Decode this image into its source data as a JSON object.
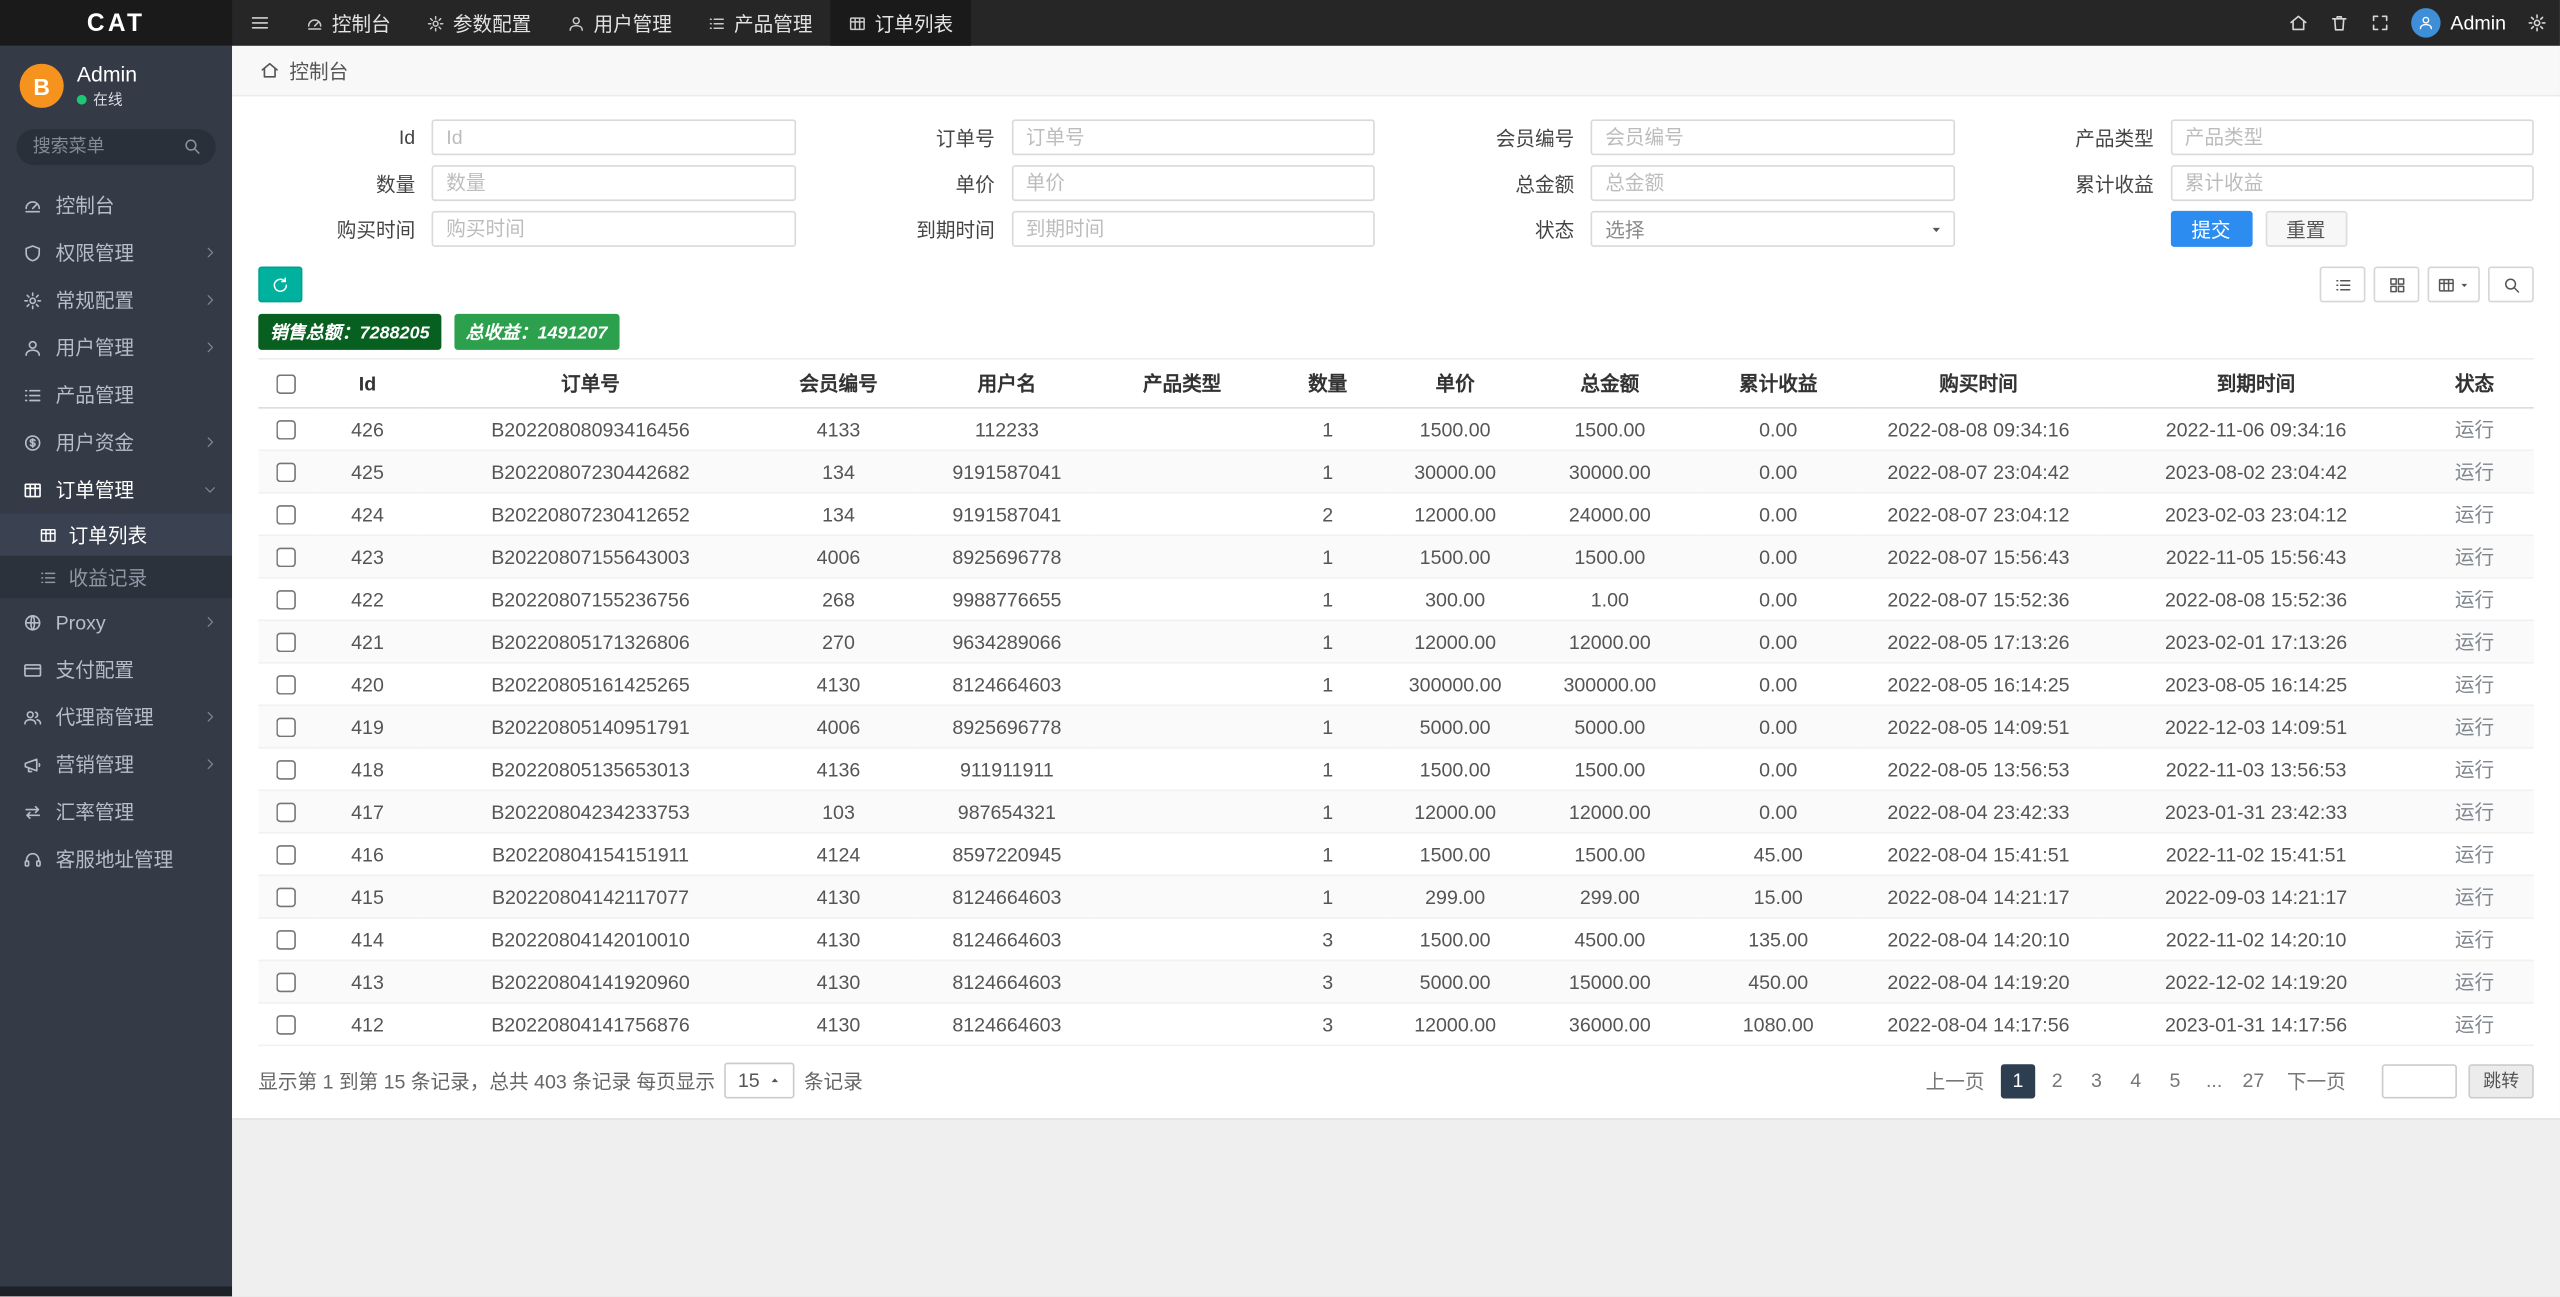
{
  "brand": {
    "logo": "CAT"
  },
  "topnav": {
    "items": [
      {
        "label": "控制台",
        "icon": "gauge"
      },
      {
        "label": "参数配置",
        "icon": "gear"
      },
      {
        "label": "用户管理",
        "icon": "user"
      },
      {
        "label": "产品管理",
        "icon": "list"
      },
      {
        "label": "订单列表",
        "icon": "table",
        "active": true
      }
    ],
    "user_label": "Admin"
  },
  "sidebar": {
    "user": {
      "name": "Admin",
      "status": "在线",
      "avatar_letter": "B"
    },
    "search_placeholder": "搜索菜单",
    "items": [
      {
        "label": "控制台",
        "icon": "gauge"
      },
      {
        "label": "权限管理",
        "icon": "shield",
        "expandable": true
      },
      {
        "label": "常规配置",
        "icon": "gear",
        "expandable": true
      },
      {
        "label": "用户管理",
        "icon": "user",
        "expandable": true
      },
      {
        "label": "产品管理",
        "icon": "list"
      },
      {
        "label": "用户资金",
        "icon": "money",
        "expandable": true
      },
      {
        "label": "订单管理",
        "icon": "table",
        "expandable": true,
        "expanded": true,
        "children": [
          {
            "label": "订单列表",
            "icon": "table",
            "active": true
          },
          {
            "label": "收益记录",
            "icon": "list"
          }
        ]
      },
      {
        "label": "Proxy",
        "icon": "globe",
        "expandable": true
      },
      {
        "label": "支付配置",
        "icon": "card"
      },
      {
        "label": "代理商管理",
        "icon": "users",
        "expandable": true
      },
      {
        "label": "营销管理",
        "icon": "megaphone",
        "expandable": true
      },
      {
        "label": "汇率管理",
        "icon": "exchange"
      },
      {
        "label": "客服地址管理",
        "icon": "headset"
      }
    ]
  },
  "breadcrumb": {
    "label": "控制台"
  },
  "filters": {
    "fields": [
      {
        "label": "Id",
        "placeholder": "Id"
      },
      {
        "label": "订单号",
        "placeholder": "订单号"
      },
      {
        "label": "会员编号",
        "placeholder": "会员编号"
      },
      {
        "label": "产品类型",
        "placeholder": "产品类型"
      },
      {
        "label": "数量",
        "placeholder": "数量"
      },
      {
        "label": "单价",
        "placeholder": "单价"
      },
      {
        "label": "总金额",
        "placeholder": "总金额"
      },
      {
        "label": "累计收益",
        "placeholder": "累计收益"
      },
      {
        "label": "购买时间",
        "placeholder": "购买时间"
      },
      {
        "label": "到期时间",
        "placeholder": "到期时间"
      },
      {
        "label": "状态",
        "type": "select",
        "value": "选择"
      }
    ],
    "submit_label": "提交",
    "reset_label": "重置"
  },
  "summary": {
    "sales_label": "销售总额：",
    "sales_value": "7288205",
    "profit_label": "总收益：",
    "profit_value": "1491207"
  },
  "table": {
    "columns": [
      "Id",
      "订单号",
      "会员编号",
      "用户名",
      "产品类型",
      "数量",
      "单价",
      "总金额",
      "累计收益",
      "购买时间",
      "到期时间",
      "状态"
    ],
    "rows": [
      [
        "426",
        "B20220808093416456",
        "4133",
        "112233",
        "",
        "1",
        "1500.00",
        "1500.00",
        "0.00",
        "2022-08-08 09:34:16",
        "2022-11-06 09:34:16",
        "运行"
      ],
      [
        "425",
        "B20220807230442682",
        "134",
        "9191587041",
        "",
        "1",
        "30000.00",
        "30000.00",
        "0.00",
        "2022-08-07 23:04:42",
        "2023-08-02 23:04:42",
        "运行"
      ],
      [
        "424",
        "B20220807230412652",
        "134",
        "9191587041",
        "",
        "2",
        "12000.00",
        "24000.00",
        "0.00",
        "2022-08-07 23:04:12",
        "2023-02-03 23:04:12",
        "运行"
      ],
      [
        "423",
        "B20220807155643003",
        "4006",
        "8925696778",
        "",
        "1",
        "1500.00",
        "1500.00",
        "0.00",
        "2022-08-07 15:56:43",
        "2022-11-05 15:56:43",
        "运行"
      ],
      [
        "422",
        "B20220807155236756",
        "268",
        "9988776655",
        "",
        "1",
        "300.00",
        "1.00",
        "0.00",
        "2022-08-07 15:52:36",
        "2022-08-08 15:52:36",
        "运行"
      ],
      [
        "421",
        "B20220805171326806",
        "270",
        "9634289066",
        "",
        "1",
        "12000.00",
        "12000.00",
        "0.00",
        "2022-08-05 17:13:26",
        "2023-02-01 17:13:26",
        "运行"
      ],
      [
        "420",
        "B20220805161425265",
        "4130",
        "8124664603",
        "",
        "1",
        "300000.00",
        "300000.00",
        "0.00",
        "2022-08-05 16:14:25",
        "2023-08-05 16:14:25",
        "运行"
      ],
      [
        "419",
        "B20220805140951791",
        "4006",
        "8925696778",
        "",
        "1",
        "5000.00",
        "5000.00",
        "0.00",
        "2022-08-05 14:09:51",
        "2022-12-03 14:09:51",
        "运行"
      ],
      [
        "418",
        "B20220805135653013",
        "4136",
        "911911911",
        "",
        "1",
        "1500.00",
        "1500.00",
        "0.00",
        "2022-08-05 13:56:53",
        "2022-11-03 13:56:53",
        "运行"
      ],
      [
        "417",
        "B20220804234233753",
        "103",
        "987654321",
        "",
        "1",
        "12000.00",
        "12000.00",
        "0.00",
        "2022-08-04 23:42:33",
        "2023-01-31 23:42:33",
        "运行"
      ],
      [
        "416",
        "B20220804154151911",
        "4124",
        "8597220945",
        "",
        "1",
        "1500.00",
        "1500.00",
        "45.00",
        "2022-08-04 15:41:51",
        "2022-11-02 15:41:51",
        "运行"
      ],
      [
        "415",
        "B20220804142117077",
        "4130",
        "8124664603",
        "",
        "1",
        "299.00",
        "299.00",
        "15.00",
        "2022-08-04 14:21:17",
        "2022-09-03 14:21:17",
        "运行"
      ],
      [
        "414",
        "B20220804142010010",
        "4130",
        "8124664603",
        "",
        "3",
        "1500.00",
        "4500.00",
        "135.00",
        "2022-08-04 14:20:10",
        "2022-11-02 14:20:10",
        "运行"
      ],
      [
        "413",
        "B20220804141920960",
        "4130",
        "8124664603",
        "",
        "3",
        "5000.00",
        "15000.00",
        "450.00",
        "2022-08-04 14:19:20",
        "2022-12-02 14:19:20",
        "运行"
      ],
      [
        "412",
        "B20220804141756876",
        "4130",
        "8124664603",
        "",
        "3",
        "12000.00",
        "36000.00",
        "1080.00",
        "2022-08-04 14:17:56",
        "2023-01-31 14:17:56",
        "运行"
      ]
    ]
  },
  "pagination": {
    "info_prefix": "显示第 1 到第 15 条记录，总共 403 条记录 每页显示",
    "per_page": "15",
    "info_suffix": "条记录",
    "prev": "上一页",
    "pages": [
      "1",
      "2",
      "3",
      "4",
      "5",
      "...",
      "27"
    ],
    "active_page": "1",
    "next": "下一页",
    "jump_label": "跳转"
  },
  "colors": {
    "accent_blue": "#2d8cf0",
    "refresh_teal": "#00b19d",
    "badge_dark_green": "#07601f",
    "badge_green": "#2ca04c",
    "pagination_active": "#2c3e50",
    "online_green": "#1dc774",
    "avatar_orange": "#f6921e"
  }
}
